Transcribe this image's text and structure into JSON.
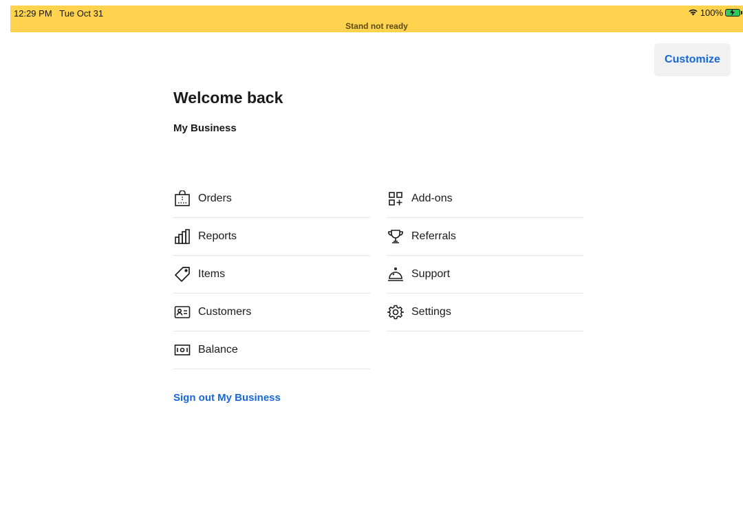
{
  "status_bar": {
    "time": "12:29 PM",
    "date": "Tue Oct 31",
    "banner": "Stand not ready",
    "battery_text": "100%",
    "wifi_icon": "wifi-icon",
    "background_color": "#ffd34d"
  },
  "header": {
    "customize_label": "Customize"
  },
  "main": {
    "title": "Welcome back",
    "business_name": "My Business",
    "signout_label": "Sign out My Business"
  },
  "menu": {
    "left": [
      {
        "label": "Orders",
        "icon": "shopping-bag-icon"
      },
      {
        "label": "Reports",
        "icon": "bar-chart-icon"
      },
      {
        "label": "Items",
        "icon": "tag-icon"
      },
      {
        "label": "Customers",
        "icon": "contact-card-icon"
      },
      {
        "label": "Balance",
        "icon": "cash-icon"
      }
    ],
    "right": [
      {
        "label": "Add-ons",
        "icon": "grid-plus-icon"
      },
      {
        "label": "Referrals",
        "icon": "trophy-icon"
      },
      {
        "label": "Support",
        "icon": "service-bell-icon"
      },
      {
        "label": "Settings",
        "icon": "gear-icon"
      }
    ]
  },
  "colors": {
    "accent": "#1667d9",
    "status_yellow": "#ffd34d",
    "battery_green": "#34c759"
  }
}
